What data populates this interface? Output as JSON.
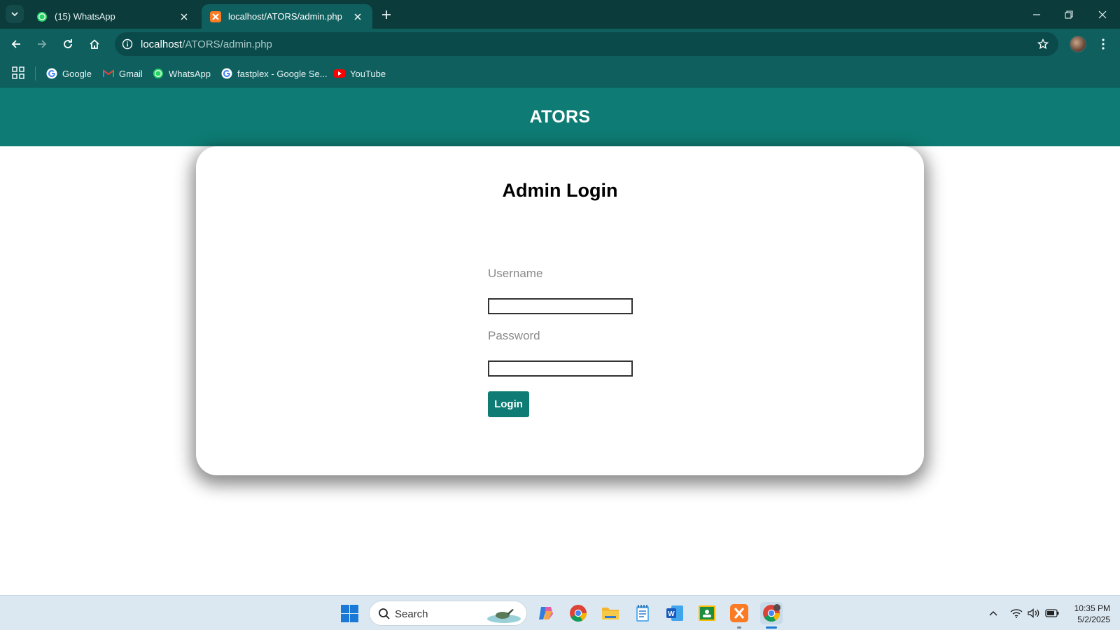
{
  "browser": {
    "tabs": [
      {
        "title": "(15) WhatsApp",
        "favicon": "whatsapp-icon",
        "active": false
      },
      {
        "title": "localhost/ATORS/admin.php",
        "favicon": "xampp-icon",
        "active": true
      }
    ],
    "address": {
      "host": "localhost",
      "path": "/ATORS/admin.php"
    },
    "bookmarks": [
      {
        "label": "Google",
        "icon": "google-icon"
      },
      {
        "label": "Gmail",
        "icon": "gmail-icon"
      },
      {
        "label": "WhatsApp",
        "icon": "whatsapp-icon"
      },
      {
        "label": "fastplex - Google Se...",
        "icon": "google-icon"
      },
      {
        "label": "YouTube",
        "icon": "youtube-icon"
      }
    ]
  },
  "page": {
    "site_title": "ATORS",
    "login": {
      "title": "Admin Login",
      "username_label": "Username",
      "username_value": "",
      "password_label": "Password",
      "password_value": "",
      "submit_label": "Login"
    }
  },
  "taskbar": {
    "search_placeholder": "Search",
    "apps": [
      "copilot-icon",
      "chrome-icon",
      "file-explorer-icon",
      "notepad-icon",
      "word-icon",
      "classroom-icon",
      "xampp-icon",
      "chrome-profile-icon"
    ],
    "time": "10:35 PM",
    "date": "5/2/2025"
  },
  "colors": {
    "header": "#0e7c74",
    "button": "#0e7c74",
    "chrome_dark": "#0b3b3b",
    "chrome_toolbar": "#0f5f5f"
  }
}
